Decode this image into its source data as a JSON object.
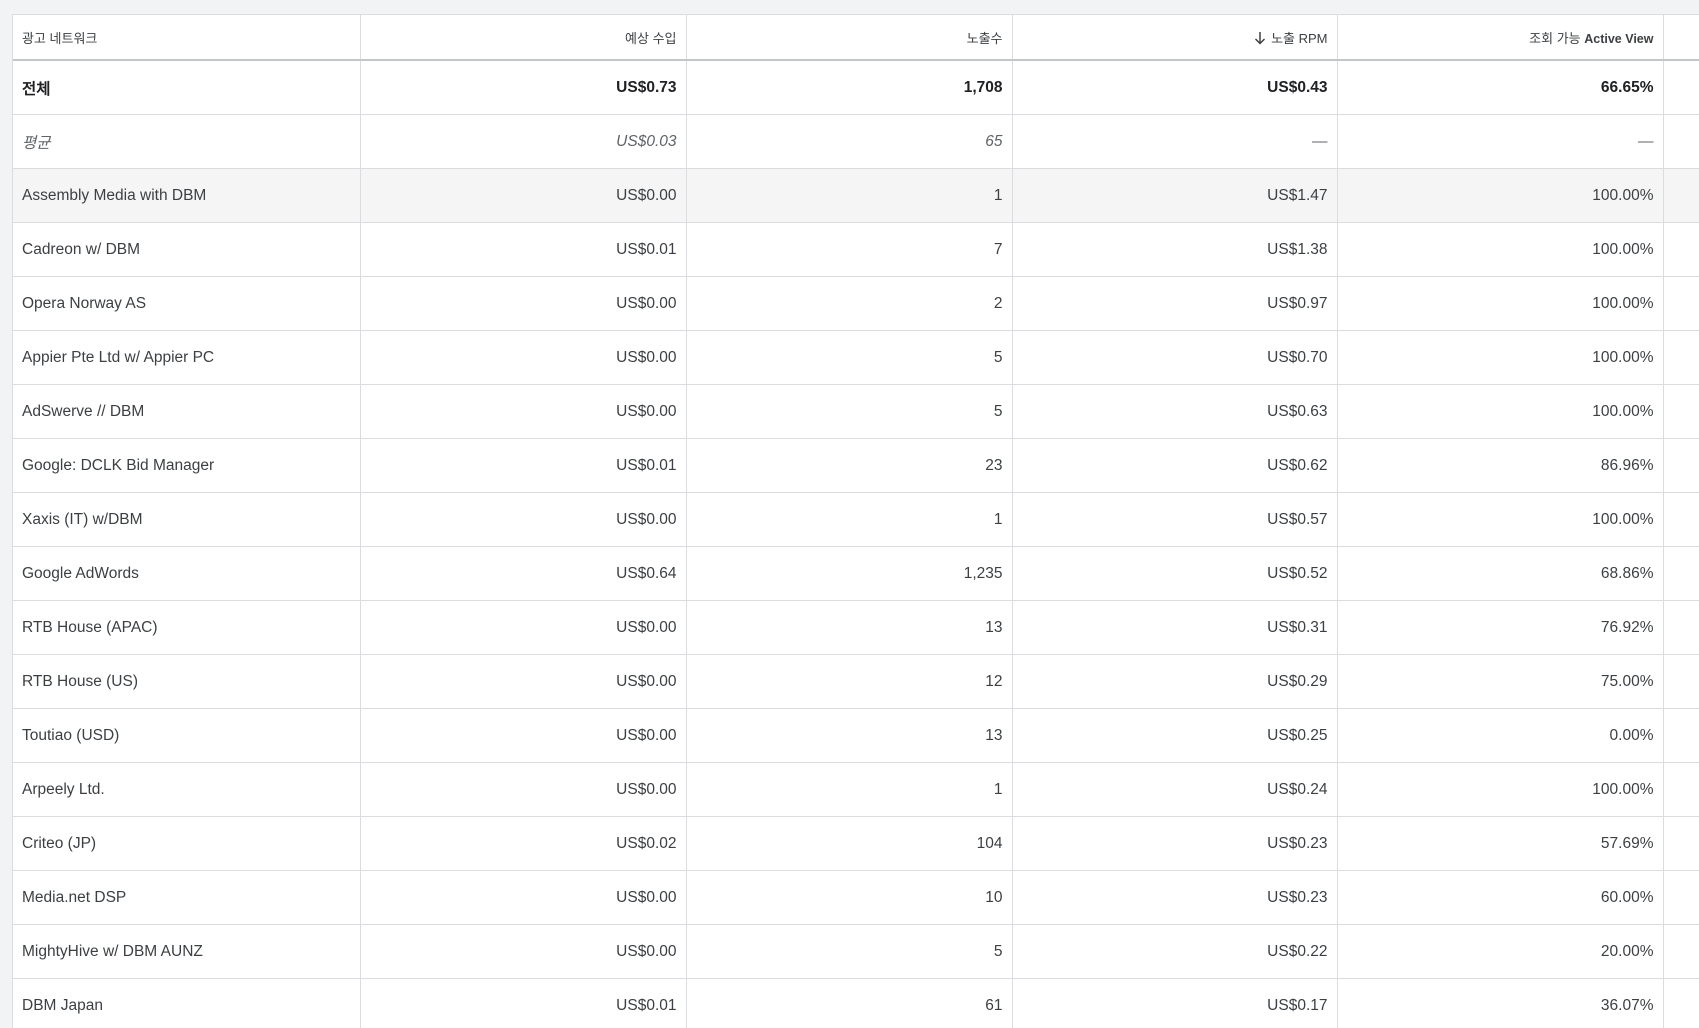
{
  "table": {
    "headers": {
      "network": "광고 네트워크",
      "revenue": "예상 수입",
      "impressions": "노출수",
      "rpm": "노출 RPM",
      "viewability_ko": "조회 가능",
      "viewability_en": "Active View"
    },
    "sorted_column": "rpm",
    "sort_direction": "descending",
    "total": {
      "label": "전체",
      "revenue": "US$0.73",
      "impressions": "1,708",
      "rpm": "US$0.43",
      "viewability": "66.65%"
    },
    "average": {
      "label": "평균",
      "revenue": "US$0.03",
      "impressions": "65",
      "rpm": "—",
      "viewability": "—"
    },
    "rows": [
      {
        "network": "Assembly Media with DBM",
        "revenue": "US$0.00",
        "impressions": "1",
        "rpm": "US$1.47",
        "viewability": "100.00%"
      },
      {
        "network": "Cadreon w/ DBM",
        "revenue": "US$0.01",
        "impressions": "7",
        "rpm": "US$1.38",
        "viewability": "100.00%"
      },
      {
        "network": "Opera Norway AS",
        "revenue": "US$0.00",
        "impressions": "2",
        "rpm": "US$0.97",
        "viewability": "100.00%"
      },
      {
        "network": "Appier Pte Ltd w/ Appier PC",
        "revenue": "US$0.00",
        "impressions": "5",
        "rpm": "US$0.70",
        "viewability": "100.00%"
      },
      {
        "network": "AdSwerve // DBM",
        "revenue": "US$0.00",
        "impressions": "5",
        "rpm": "US$0.63",
        "viewability": "100.00%"
      },
      {
        "network": "Google: DCLK Bid Manager",
        "revenue": "US$0.01",
        "impressions": "23",
        "rpm": "US$0.62",
        "viewability": "86.96%"
      },
      {
        "network": "Xaxis (IT) w/DBM",
        "revenue": "US$0.00",
        "impressions": "1",
        "rpm": "US$0.57",
        "viewability": "100.00%"
      },
      {
        "network": "Google AdWords",
        "revenue": "US$0.64",
        "impressions": "1,235",
        "rpm": "US$0.52",
        "viewability": "68.86%"
      },
      {
        "network": "RTB House (APAC)",
        "revenue": "US$0.00",
        "impressions": "13",
        "rpm": "US$0.31",
        "viewability": "76.92%"
      },
      {
        "network": "RTB House (US)",
        "revenue": "US$0.00",
        "impressions": "12",
        "rpm": "US$0.29",
        "viewability": "75.00%"
      },
      {
        "network": "Toutiao (USD)",
        "revenue": "US$0.00",
        "impressions": "13",
        "rpm": "US$0.25",
        "viewability": "0.00%"
      },
      {
        "network": "Arpeely Ltd.",
        "revenue": "US$0.00",
        "impressions": "1",
        "rpm": "US$0.24",
        "viewability": "100.00%"
      },
      {
        "network": "Criteo (JP)",
        "revenue": "US$0.02",
        "impressions": "104",
        "rpm": "US$0.23",
        "viewability": "57.69%"
      },
      {
        "network": "Media.net DSP",
        "revenue": "US$0.00",
        "impressions": "10",
        "rpm": "US$0.23",
        "viewability": "60.00%"
      },
      {
        "network": "MightyHive w/ DBM AUNZ",
        "revenue": "US$0.00",
        "impressions": "5",
        "rpm": "US$0.22",
        "viewability": "20.00%"
      },
      {
        "network": "DBM Japan",
        "revenue": "US$0.01",
        "impressions": "61",
        "rpm": "US$0.17",
        "viewability": "36.07%"
      }
    ]
  },
  "icons": {
    "sort": "arrow-down-icon"
  },
  "colors": {
    "border": "#dadce0",
    "hover_row": "#f5f5f5",
    "text": "#3c4043"
  }
}
